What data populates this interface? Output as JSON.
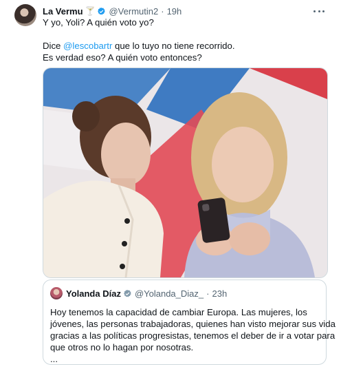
{
  "tweet": {
    "author_name": "La Vermu",
    "author_emoji": "🍸",
    "handle": "@Vermutin2",
    "separator": "·",
    "time": "19h",
    "line1": "Y yo, Yoli? A quién voto yo?",
    "line2_before": "Dice ",
    "line2_mention": "@lescobartr",
    "line2_after": " que lo tuyo no tiene recorrido.",
    "line3": "Es verdad eso? A quién voto entonces?"
  },
  "quote": {
    "author_name": "Yolanda Díaz",
    "handle": "@Yolanda_Diaz_",
    "separator": "·",
    "time": "23h",
    "lines": [
      "Hoy tenemos la capacidad de cambiar Europa. Las mujeres, los",
      "jóvenes, las personas trabajadoras, quienes han visto mejorar sus vida",
      "gracias a las políticas progresistas, tenemos el deber de ir a votar para",
      "que otros no lo hagan por nosotras.",
      "..."
    ]
  },
  "colors": {
    "link": "#1d9bf0",
    "secondary_text": "#536471",
    "border": "#cfd9de",
    "verified": "#1d9bf0"
  },
  "icons": {
    "verified": "verified-badge-icon",
    "more": "more-options-icon"
  }
}
